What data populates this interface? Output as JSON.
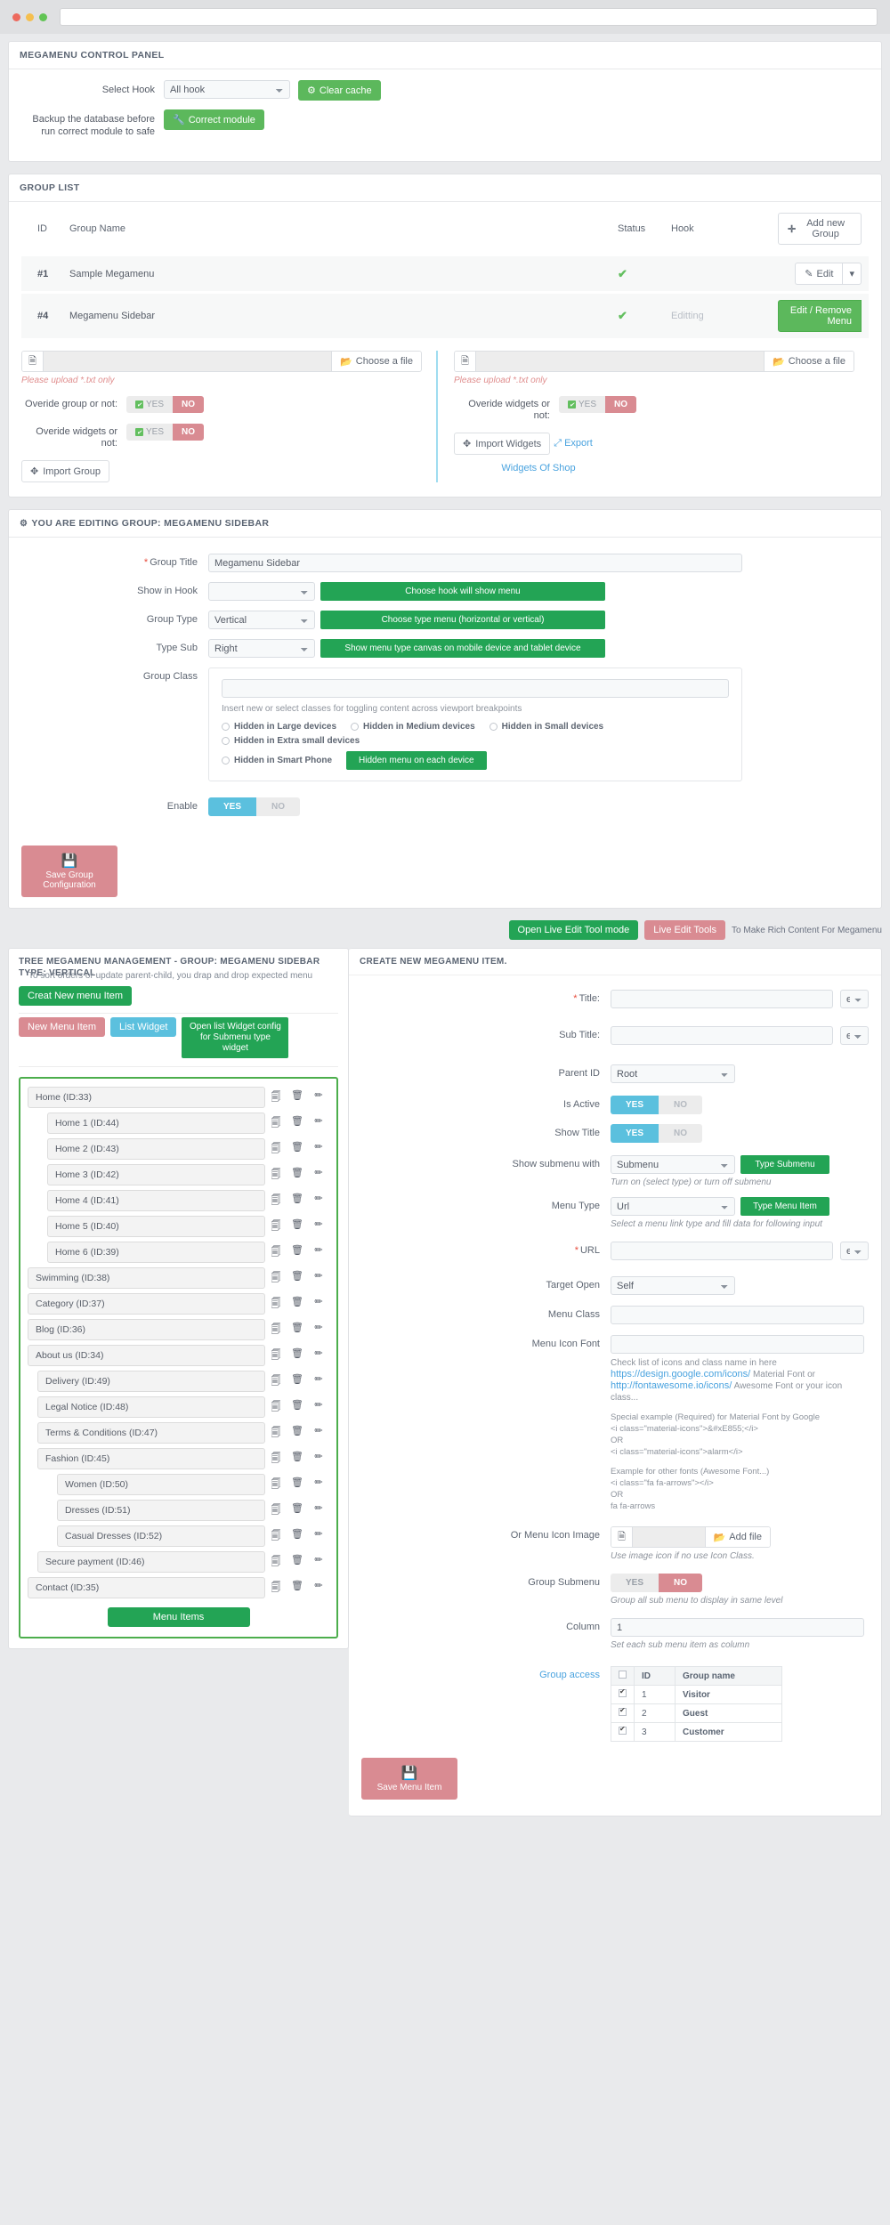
{
  "browser": {
    "url": ""
  },
  "control_panel": {
    "title": "MEGAMENU CONTROL PANEL",
    "select_hook_label": "Select Hook",
    "hook_value": "All hook",
    "clear_cache_label": "Clear cache",
    "backup_label": "Backup the database before run correct module to safe",
    "correct_module_label": "Correct module"
  },
  "group_list": {
    "title": "GROUP LIST",
    "columns": [
      "ID",
      "Group Name",
      "Status",
      "Hook"
    ],
    "add_new_group_label": "Add new Group",
    "rows": [
      {
        "id": "#1",
        "name": "Sample Megamenu",
        "status": "✔",
        "hook": "",
        "action": "Edit",
        "action_type": "split"
      },
      {
        "id": "#4",
        "name": "Megamenu Sidebar",
        "status": "✔",
        "hook": "Editting",
        "action": "Edit / Remove Menu",
        "action_type": "remove"
      }
    ],
    "file_left": {
      "choose_label": "Choose a file",
      "help": "Please upload *.txt only",
      "override_group_label": "Overide group or not:",
      "override_widgets_label": "Overide widgets or not:",
      "yes": "YES",
      "no": "NO",
      "import_label": "Import Group"
    },
    "file_right": {
      "choose_label": "Choose a file",
      "help": "Please upload *.txt only",
      "override_widgets_label": "Overide widgets or not:",
      "yes": "YES",
      "no": "NO",
      "import_label": "Import Widgets",
      "export_label": "Export",
      "widgets_of_shop_label": "Widgets Of Shop"
    }
  },
  "editing_group": {
    "title": "YOU ARE EDITING GROUP: MEGAMENU SIDEBAR",
    "group_title_label": "Group Title",
    "group_title_value": "Megamenu Sidebar",
    "show_in_hook_label": "Show in Hook",
    "show_in_hook_value": "",
    "show_in_hook_hint": "Choose hook will show menu",
    "group_type_label": "Group Type",
    "group_type_value": "Vertical",
    "group_type_hint": "Choose type menu (horizontal or vertical)",
    "type_sub_label": "Type Sub",
    "type_sub_value": "Right",
    "type_sub_hint": "Show menu type canvas on mobile device and tablet device",
    "group_class_label": "Group Class",
    "group_class_value": "",
    "group_class_note": "Insert new or select classes for toggling content across viewport breakpoints",
    "class_options": [
      "Hidden in Large devices",
      "Hidden in Medium devices",
      "Hidden in Small devices",
      "Hidden in Extra small devices",
      "Hidden in Smart Phone"
    ],
    "class_hint": "Hidden menu on each device",
    "enable_label": "Enable",
    "enable_yes": "YES",
    "enable_no": "NO",
    "save_label": "Save Group Configuration"
  },
  "live_edit": {
    "open_tool_label": "Open Live Edit Tool mode",
    "live_edit_label": "Live Edit Tools",
    "note": "To Make Rich Content For Megamenu"
  },
  "tree": {
    "title": "TREE MEGAMENU MANAGEMENT - GROUP: MEGAMENU SIDEBAR",
    "type_label": "TYPE: VERTICAL",
    "sort_note": "To sort orders or update parent-child, you drap and drop expected menu",
    "create_new_label": "Creat New menu Item",
    "new_menu_item_label": "New Menu Item",
    "list_widget_label": "List Widget",
    "open_list_widget_label": "Open list Widget config for Submenu type widget",
    "menu_items_button": "Menu Items",
    "icons": {
      "copy": "copy-icon",
      "delete": "delete-icon",
      "edit": "edit-icon"
    },
    "items": [
      {
        "label": "Home (ID:33)",
        "level": 0
      },
      {
        "label": "Home 1 (ID:44)",
        "level": 1
      },
      {
        "label": "Home 2 (ID:43)",
        "level": 1
      },
      {
        "label": "Home 3 (ID:42)",
        "level": 1
      },
      {
        "label": "Home 4 (ID:41)",
        "level": 1
      },
      {
        "label": "Home 5 (ID:40)",
        "level": 1
      },
      {
        "label": "Home 6 (ID:39)",
        "level": 1
      },
      {
        "label": "Swimming (ID:38)",
        "level": 0
      },
      {
        "label": "Category (ID:37)",
        "level": 0
      },
      {
        "label": "Blog (ID:36)",
        "level": 0
      },
      {
        "label": "About us (ID:34)",
        "level": 0
      },
      {
        "label": "Delivery (ID:49)",
        "level": 1
      },
      {
        "label": "Legal Notice (ID:48)",
        "level": 1
      },
      {
        "label": "Terms & Conditions (ID:47)",
        "level": 1
      },
      {
        "label": "Fashion (ID:45)",
        "level": 1
      },
      {
        "label": "Women (ID:50)",
        "level": 2
      },
      {
        "label": "Dresses (ID:51)",
        "level": 2
      },
      {
        "label": "Casual Dresses (ID:52)",
        "level": 2
      },
      {
        "label": "Secure payment (ID:46)",
        "level": 1
      },
      {
        "label": "Contact (ID:35)",
        "level": 0
      }
    ]
  },
  "create_item": {
    "title": "CREATE NEW MEGAMENU ITEM.",
    "title_label": "Title:",
    "title_value": "",
    "lang": "en",
    "sub_title_label": "Sub Title:",
    "sub_title_value": "",
    "parent_id_label": "Parent ID",
    "parent_id_value": "Root",
    "is_active_label": "Is Active",
    "show_title_label": "Show Title",
    "yes": "YES",
    "no": "NO",
    "show_submenu_label": "Show submenu with",
    "show_submenu_value": "Submenu",
    "show_submenu_hint": "Type Submenu",
    "show_submenu_note": "Turn on (select type) or turn off submenu",
    "menu_type_label": "Menu Type",
    "menu_type_value": "Url",
    "menu_type_hint": "Type Menu Item",
    "menu_type_note": "Select a menu link type and fill data for following input",
    "url_label": "URL",
    "url_value": "",
    "target_open_label": "Target Open",
    "target_open_value": "Self",
    "menu_class_label": "Menu Class",
    "menu_class_value": "",
    "menu_icon_font_label": "Menu Icon Font",
    "menu_icon_font_value": "",
    "icon_note_prefix": "Check list of icons and class name in here",
    "icon_note_link1": "https://design.google.com/icons/",
    "icon_note_mid": "Material Font or",
    "icon_note_link2": "http://fontawesome.io/icons/",
    "icon_note_suffix": "Awesome Font or your icon class...",
    "code_note_1": "Special example (Required) for Material Font by Google",
    "code_note_2": "<i class=\"material-icons\">&#xE855;</i>",
    "code_note_3": "OR",
    "code_note_4": "<i class=\"material-icons\">alarm</i>",
    "code_note_5": "Example for other fonts (Awesome Font...)",
    "code_note_6": "<i class=\"fa fa-arrows\"></i>",
    "code_note_7": "OR",
    "code_note_8": "fa fa-arrows",
    "icon_image_label": "Or Menu Icon Image",
    "add_file_label": "Add file",
    "icon_image_note": "Use image icon if no use Icon Class.",
    "group_submenu_label": "Group Submenu",
    "group_submenu_note": "Group all sub menu to display in same level",
    "column_label": "Column",
    "column_value": "1",
    "column_note": "Set each sub menu item as column",
    "group_access_label": "Group access",
    "group_access_columns": [
      "",
      "ID",
      "Group name"
    ],
    "group_access_rows": [
      {
        "checked": true,
        "id": "1",
        "name": "Visitor"
      },
      {
        "checked": true,
        "id": "2",
        "name": "Guest"
      },
      {
        "checked": true,
        "id": "3",
        "name": "Customer"
      }
    ],
    "save_label": "Save Menu Item"
  },
  "colors": {
    "green": "#5cb85c",
    "green_dark": "#23a455",
    "red": "#d98b92",
    "blue": "#5bc0de",
    "link": "#4aa3df"
  }
}
